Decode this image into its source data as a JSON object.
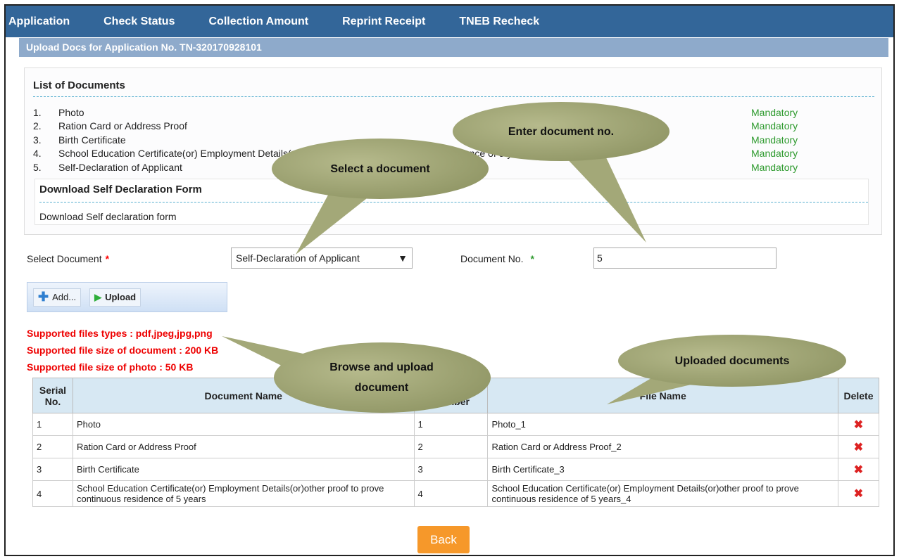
{
  "nav": [
    "Application",
    "Check Status",
    "Collection Amount",
    "Reprint Receipt",
    "TNEB Recheck"
  ],
  "subheader": "Upload Docs for Application No. TN-320170928101",
  "documents_list": {
    "title": "List of Documents",
    "items": [
      {
        "n": "1.",
        "name": "Photo",
        "status": "Mandatory"
      },
      {
        "n": "2.",
        "name": "Ration Card or Address Proof",
        "status": "Mandatory"
      },
      {
        "n": "3.",
        "name": "Birth Certificate",
        "status": "Mandatory"
      },
      {
        "n": "4.",
        "name": "School Education Certificate(or) Employment Details(or)other proof to prove continuous residence of 5 years",
        "status": "Mandatory"
      },
      {
        "n": "5.",
        "name": "Self-Declaration of Applicant",
        "status": "Mandatory"
      }
    ]
  },
  "download": {
    "title": "Download Self Declaration Form",
    "link": "Download Self declaration form"
  },
  "form": {
    "select_label": "Select Document",
    "select_value": "Self-Declaration of Applicant",
    "docno_label": "Document No.",
    "docno_value": "5",
    "required": "*"
  },
  "toolbar": {
    "add": "Add...",
    "upload": "Upload"
  },
  "notes": [
    "Supported files types : pdf,jpeg,jpg,png",
    "Supported file size of document : 200 KB",
    "Supported file size of photo : 50 KB"
  ],
  "table": {
    "headers": [
      "Serial No.",
      "Document Name",
      "Document Number",
      "File Name",
      "Delete"
    ],
    "rows": [
      [
        "1",
        "Photo",
        "1",
        "Photo_1"
      ],
      [
        "2",
        "Ration Card or Address Proof",
        "2",
        "Ration Card or Address Proof_2"
      ],
      [
        "3",
        "Birth Certificate",
        "3",
        "Birth Certificate_3"
      ],
      [
        "4",
        "School Education Certificate(or) Employment Details(or)other proof to prove continuous residence of 5 years",
        "4",
        "School Education Certificate(or) Employment Details(or)other proof to prove continuous residence of 5 years_4"
      ]
    ]
  },
  "back": "Back",
  "callouts": {
    "select": "Select a document",
    "enter": "Enter document no.",
    "browse": "Browse and upload document",
    "uploaded": "Uploaded documents"
  },
  "colors": {
    "nav": "#336699",
    "mandatory": "#2e9a2e",
    "note": "#ee0000",
    "back": "#f6982a",
    "callout": "#a3a878"
  }
}
